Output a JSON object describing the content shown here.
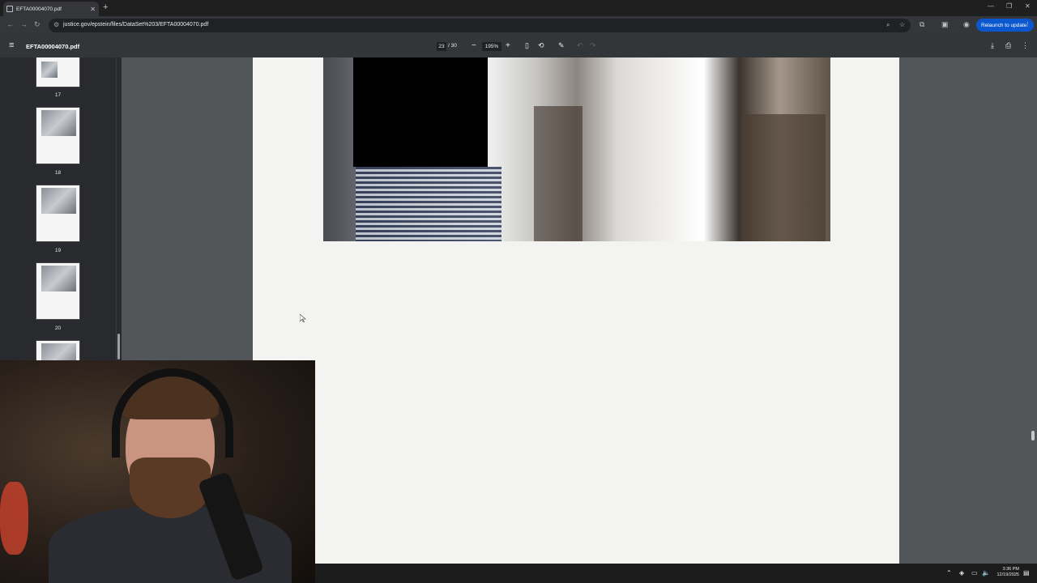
{
  "browser": {
    "tab_title": "EFTA00004070.pdf",
    "url": "justice.gov/epstein/files/DataSet%203/EFTA00004070.pdf",
    "relaunch_label": "Relaunch to update"
  },
  "pdf": {
    "filename": "EFTA00004070.pdf",
    "current_page": "23",
    "total_pages": "/ 30",
    "zoom": "195%"
  },
  "thumbnails": [
    "17",
    "18",
    "19",
    "20"
  ],
  "taskbar": {
    "time": "3:36 PM",
    "date": "12/19/2025"
  }
}
